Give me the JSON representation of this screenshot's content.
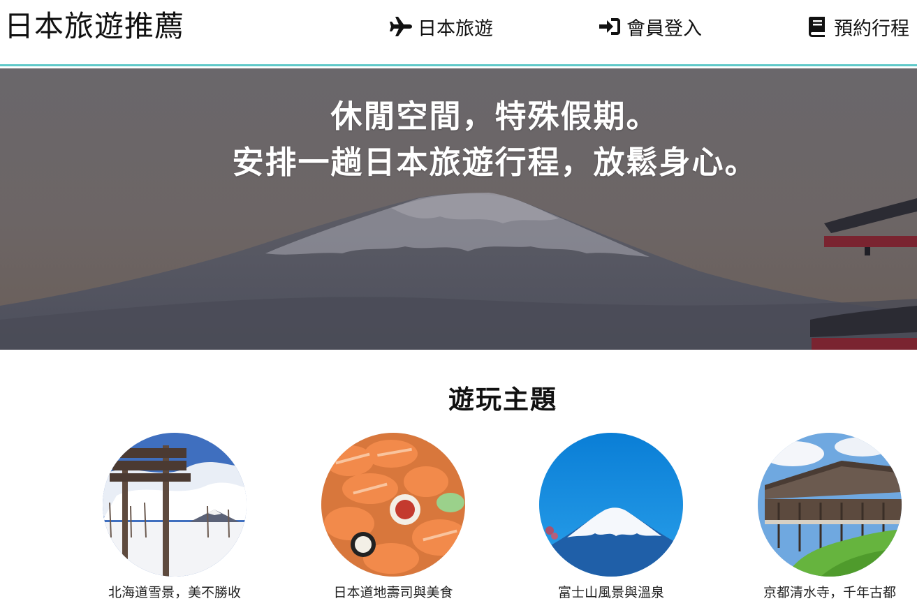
{
  "header": {
    "logo": "日本旅遊推薦",
    "nav": [
      {
        "label": "日本旅遊",
        "icon": "plane-icon"
      },
      {
        "label": "會員登入",
        "icon": "sign-in-icon"
      },
      {
        "label": "預約行程",
        "icon": "book-icon"
      }
    ],
    "accent_color": "#5fc9c9"
  },
  "hero": {
    "line1": "休閒空間，特殊假期。",
    "line2": "安排一趟日本旅遊行程，放鬆身心。"
  },
  "themes": {
    "title": "遊玩主題",
    "items": [
      {
        "caption": "北海道雪景，美不勝收"
      },
      {
        "caption": "日本道地壽司與美食"
      },
      {
        "caption": "富士山風景與溫泉"
      },
      {
        "caption": "京都清水寺，千年古都"
      }
    ]
  }
}
